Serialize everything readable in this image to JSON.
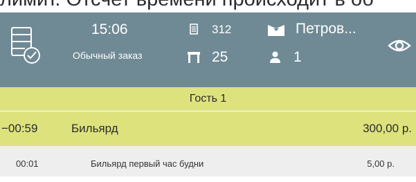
{
  "background_text": "лимит. Отсчет времени происходит в об",
  "header": {
    "time": "15:06",
    "order_type": "Обычный заказ",
    "order_number": "312",
    "table_number": "25",
    "waiter": "Петров...",
    "guests": "1",
    "icons": [
      "order-list-check-icon",
      "receipt-icon",
      "table-icon",
      "waiter-icon",
      "person-icon",
      "eye-icon"
    ],
    "colors": {
      "background": "#6f8a95",
      "text": "#ffffff"
    }
  },
  "guest_label": "Гость 1",
  "items": [
    {
      "time": "−00:59",
      "name": "Бильярд",
      "price": "300,00 р.",
      "modifiers": [
        {
          "time": "00:01",
          "name": "Бильярд первый час будни",
          "price": "5,00 р."
        }
      ]
    }
  ],
  "colors": {
    "selected_row": "#dde27d",
    "modifier_row": "#eeeeee"
  }
}
